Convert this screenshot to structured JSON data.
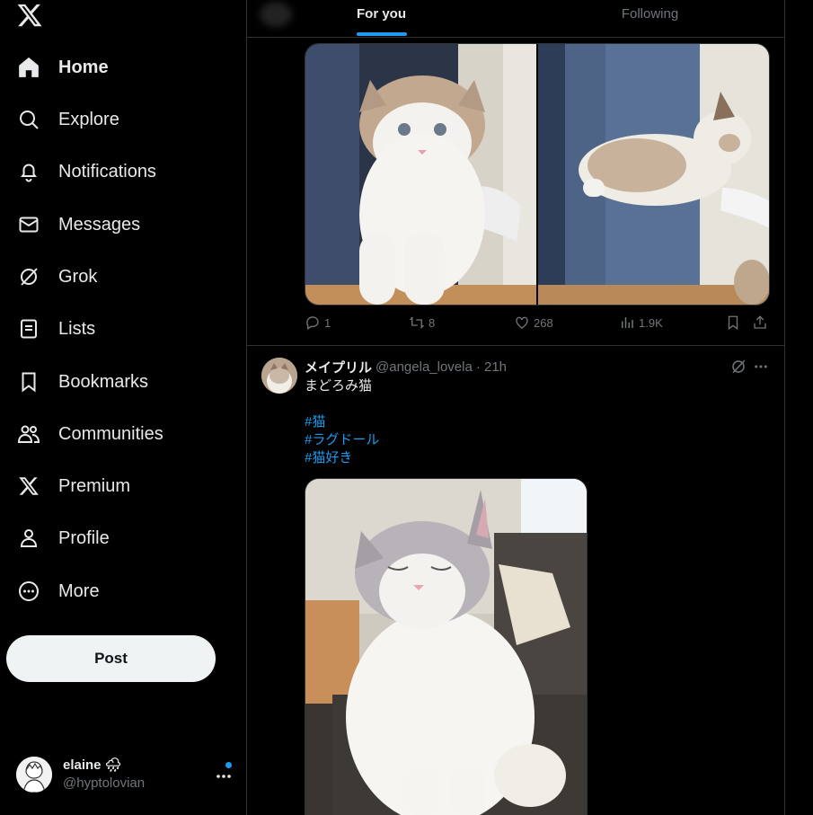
{
  "sidebar": {
    "items": [
      {
        "label": "Home",
        "icon": "home-icon"
      },
      {
        "label": "Explore",
        "icon": "search-icon"
      },
      {
        "label": "Notifications",
        "icon": "bell-icon"
      },
      {
        "label": "Messages",
        "icon": "envelope-icon"
      },
      {
        "label": "Grok",
        "icon": "grok-icon"
      },
      {
        "label": "Lists",
        "icon": "list-icon"
      },
      {
        "label": "Bookmarks",
        "icon": "bookmark-icon"
      },
      {
        "label": "Communities",
        "icon": "people-icon"
      },
      {
        "label": "Premium",
        "icon": "x-logo-icon"
      },
      {
        "label": "Profile",
        "icon": "person-icon"
      },
      {
        "label": "More",
        "icon": "more-circle-icon"
      }
    ],
    "post_label": "Post",
    "account": {
      "display_name": "elaine 🌧",
      "handle": "@hyptolovian"
    }
  },
  "tabs": [
    {
      "label": "For you",
      "active": true
    },
    {
      "label": "Following",
      "active": false
    }
  ],
  "tweet1": {
    "replies": "1",
    "retweets": "8",
    "likes": "268",
    "views": "1.9K"
  },
  "tweet2": {
    "name": "メイプリル",
    "handle": "@angela_lovela",
    "time": "· 21h",
    "text": "まどろみ猫",
    "hashtags": [
      "#猫",
      "#ラグドール",
      "#猫好き"
    ]
  },
  "colors": {
    "accent": "#1d9bf0",
    "background": "#000000",
    "text": "#e7e9ea",
    "muted": "#71767b",
    "border": "#2f3336"
  }
}
